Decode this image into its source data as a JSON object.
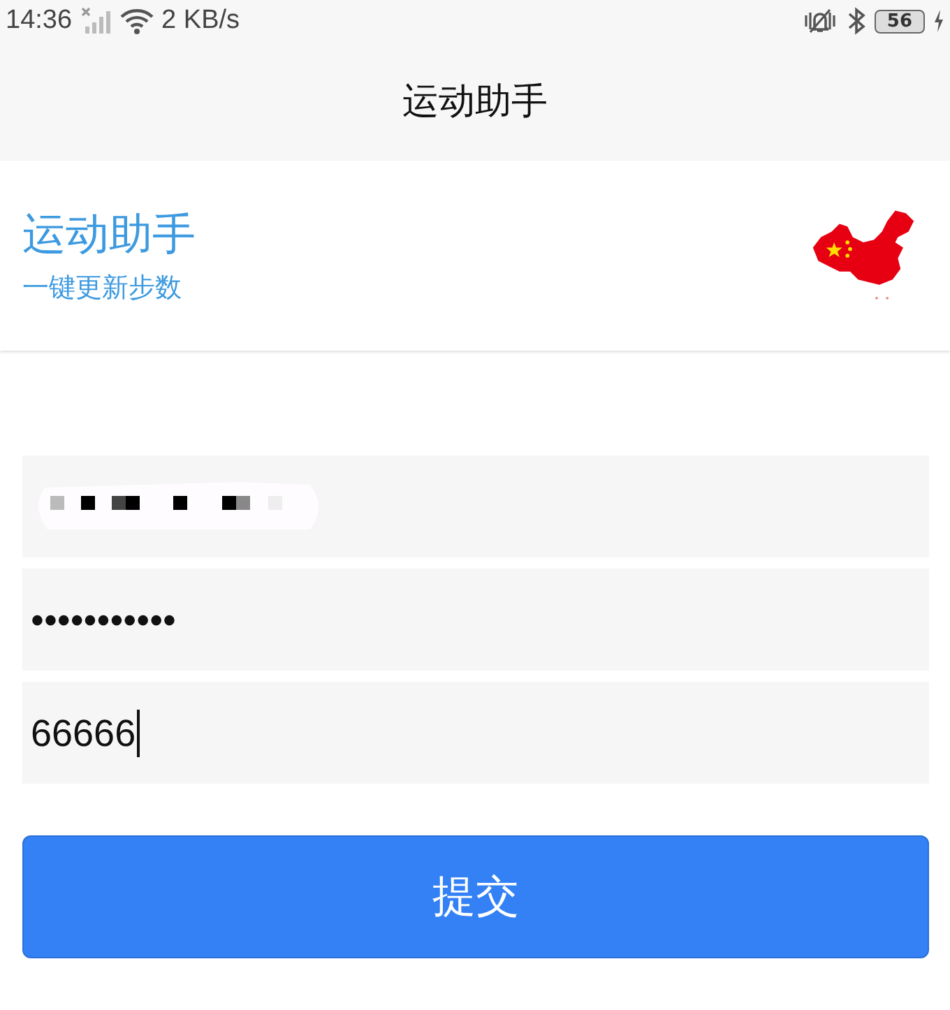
{
  "status_bar": {
    "time": "14:36",
    "speed": "2 KB/s",
    "battery": "56"
  },
  "app_bar": {
    "title": "运动助手"
  },
  "header": {
    "title": "运动助手",
    "subtitle": "一键更新步数"
  },
  "fields": [
    {
      "kind": "redacted"
    },
    {
      "kind": "text",
      "value": "•••••••••••",
      "focused": false
    },
    {
      "kind": "text",
      "value": "66666",
      "focused": true
    }
  ],
  "submit": {
    "label": "提交"
  }
}
